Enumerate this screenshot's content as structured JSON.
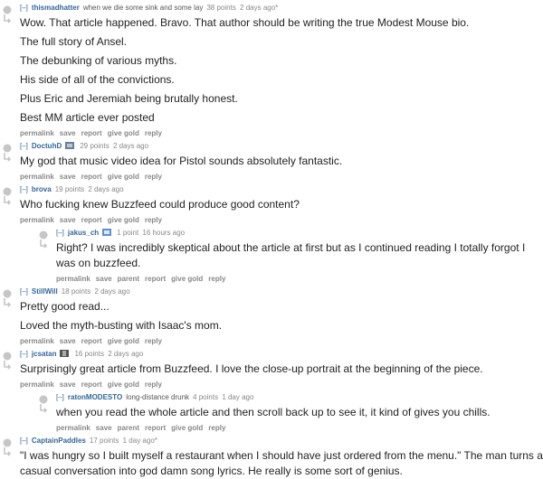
{
  "expand_label": "[–]",
  "button_labels": {
    "permalink": "permalink",
    "save": "save",
    "parent": "parent",
    "report": "report",
    "give_gold": "give gold",
    "reply": "reply"
  },
  "comments": [
    {
      "author": "thismadhatter",
      "flair": "when we die some sink and some lay",
      "score": "38 points",
      "time": "2 days ago*",
      "paragraphs": [
        "Wow. That article happened. Bravo. That author should be writing the true Modest Mouse bio.",
        "The full story of Ansel.",
        "The debunking of various myths.",
        "His side of all of the convictions.",
        "Plus Eric and Jeremiah being brutally honest.",
        "Best MM article ever posted"
      ]
    },
    {
      "author": "DoctuhD",
      "flair_icon": "flair-image-icon",
      "score": "29 points",
      "time": "2 days ago",
      "paragraphs": [
        "My god that music video idea for Pistol sounds absolutely fantastic."
      ]
    },
    {
      "author": "brova",
      "score": "19 points",
      "time": "2 days ago",
      "paragraphs": [
        "Who fucking knew Buzzfeed could produce good content?"
      ]
    },
    {
      "author": "jakus_ch",
      "flair_icon": "flair-image-icon",
      "score": "1 point",
      "time": "16 hours ago",
      "paragraphs": [
        "Right? I was incredibly skeptical about the article at first but as I continued reading I totally forgot I was on buzzfeed."
      ]
    },
    {
      "author": "StillWill",
      "score": "18 points",
      "time": "2 days ago",
      "paragraphs": [
        "Pretty good read...",
        "Loved the myth-busting with Isaac's mom."
      ]
    },
    {
      "author": "jcsatan",
      "flair_icon": "flair-image-icon",
      "score": "16 points",
      "time": "2 days ago",
      "paragraphs": [
        "Surprisingly great article from Buzzfeed. I love the close-up portrait at the beginning of the piece."
      ]
    },
    {
      "author": "ratonMODESTO",
      "flair": "long-distance drunk",
      "score": "4 points",
      "time": "1 day ago",
      "paragraphs": [
        "when you read the whole article and then scroll back up to see it, it kind of gives you chills."
      ]
    },
    {
      "author": "CaptainPaddles",
      "score": "17 points",
      "time": "1 day ago*",
      "paragraphs": [
        "\"I was hungry so I built myself a restaurant when I should have just ordered from the menu.\" The man turns a casual conversation into god damn song lyrics. He really is some sort of genius."
      ]
    }
  ]
}
